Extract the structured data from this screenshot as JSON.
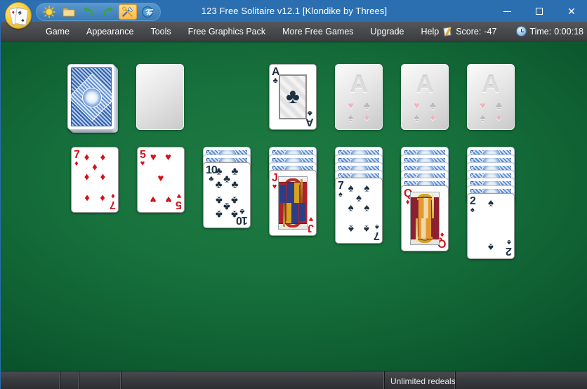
{
  "window": {
    "title": "123 Free Solitaire v12.1  [Klondike by Threes]",
    "minimize_label": "Minimize",
    "maximize_label": "Maximize",
    "close_label": "Close"
  },
  "toolbar": {
    "logo_name": "123-free-solitaire-logo",
    "buttons": [
      {
        "name": "new-game-icon",
        "label": "New Game",
        "glyph": "sun"
      },
      {
        "name": "open-game-icon",
        "label": "Open Game",
        "glyph": "folder"
      },
      {
        "name": "undo-icon",
        "label": "Undo",
        "glyph": "undo"
      },
      {
        "name": "redo-icon",
        "label": "Redo",
        "glyph": "redo"
      },
      {
        "name": "hint-icon",
        "label": "Hint",
        "glyph": "tools",
        "active": true
      },
      {
        "name": "help-icon",
        "label": "Help",
        "glyph": "question"
      }
    ],
    "overflow_label": "More toolbar buttons"
  },
  "menu": {
    "items": [
      {
        "name": "menu-game",
        "label": "Game"
      },
      {
        "name": "menu-appearance",
        "label": "Appearance"
      },
      {
        "name": "menu-tools",
        "label": "Tools"
      },
      {
        "name": "menu-free-graphics-pack",
        "label": "Free Graphics Pack"
      },
      {
        "name": "menu-more-free-games",
        "label": "More Free Games"
      },
      {
        "name": "menu-upgrade",
        "label": "Upgrade"
      },
      {
        "name": "menu-help",
        "label": "Help"
      }
    ],
    "score_label": "Score:",
    "score_value": "-47",
    "time_label": "Time:",
    "time_value": "0:00:18"
  },
  "statusbar": {
    "panels": [
      {
        "name": "status-panel-1",
        "text": ""
      },
      {
        "name": "status-panel-2",
        "text": ""
      },
      {
        "name": "status-panel-3",
        "text": ""
      },
      {
        "name": "status-panel-4",
        "text": ""
      },
      {
        "name": "status-panel-redeals",
        "text": "Unlimited redeals"
      },
      {
        "name": "status-panel-6",
        "text": ""
      }
    ],
    "resize_grip_name": "resize-grip"
  },
  "board": {
    "stock": {
      "name": "stock-pile",
      "face_down_count": 3,
      "label": "Stock"
    },
    "waste": {
      "name": "waste-pile",
      "empty": true,
      "label": "Waste"
    },
    "foundations": [
      {
        "name": "foundation-clubs",
        "empty": false,
        "rank": "A",
        "suit": "clubs",
        "color": "black",
        "placeholder": "A"
      },
      {
        "name": "foundation-slot-2",
        "empty": true,
        "placeholder": "A"
      },
      {
        "name": "foundation-slot-3",
        "empty": true,
        "placeholder": "A"
      },
      {
        "name": "foundation-slot-4",
        "empty": true,
        "placeholder": "A"
      }
    ],
    "tableau": [
      {
        "name": "tableau-column-1",
        "face_down": 0,
        "top_card": {
          "rank": "7",
          "suit": "diamonds",
          "color": "red"
        }
      },
      {
        "name": "tableau-column-2",
        "face_down": 0,
        "top_card": {
          "rank": "5",
          "suit": "hearts",
          "color": "red"
        }
      },
      {
        "name": "tableau-column-3",
        "face_down": 2,
        "top_card": {
          "rank": "10",
          "suit": "clubs",
          "color": "black"
        }
      },
      {
        "name": "tableau-column-4",
        "face_down": 3,
        "top_card": {
          "rank": "J",
          "suit": "hearts",
          "color": "red"
        }
      },
      {
        "name": "tableau-column-5",
        "face_down": 4,
        "top_card": {
          "rank": "7",
          "suit": "spades",
          "color": "black"
        }
      },
      {
        "name": "tableau-column-6",
        "face_down": 5,
        "top_card": {
          "rank": "Q",
          "suit": "diamonds",
          "color": "red"
        }
      },
      {
        "name": "tableau-column-7",
        "face_down": 6,
        "top_card": {
          "rank": "2",
          "suit": "spades",
          "color": "black"
        }
      }
    ],
    "suit_glyphs": {
      "hearts": "♥",
      "diamonds": "♦",
      "clubs": "♣",
      "spades": "♠"
    },
    "colors": {
      "red": "#d5121b",
      "black": "#1d3040",
      "felt_light": "#1e7a42",
      "felt_dark": "#074b27",
      "title_bar": "#2c6fb1",
      "menu_bar": "#48494d"
    }
  }
}
